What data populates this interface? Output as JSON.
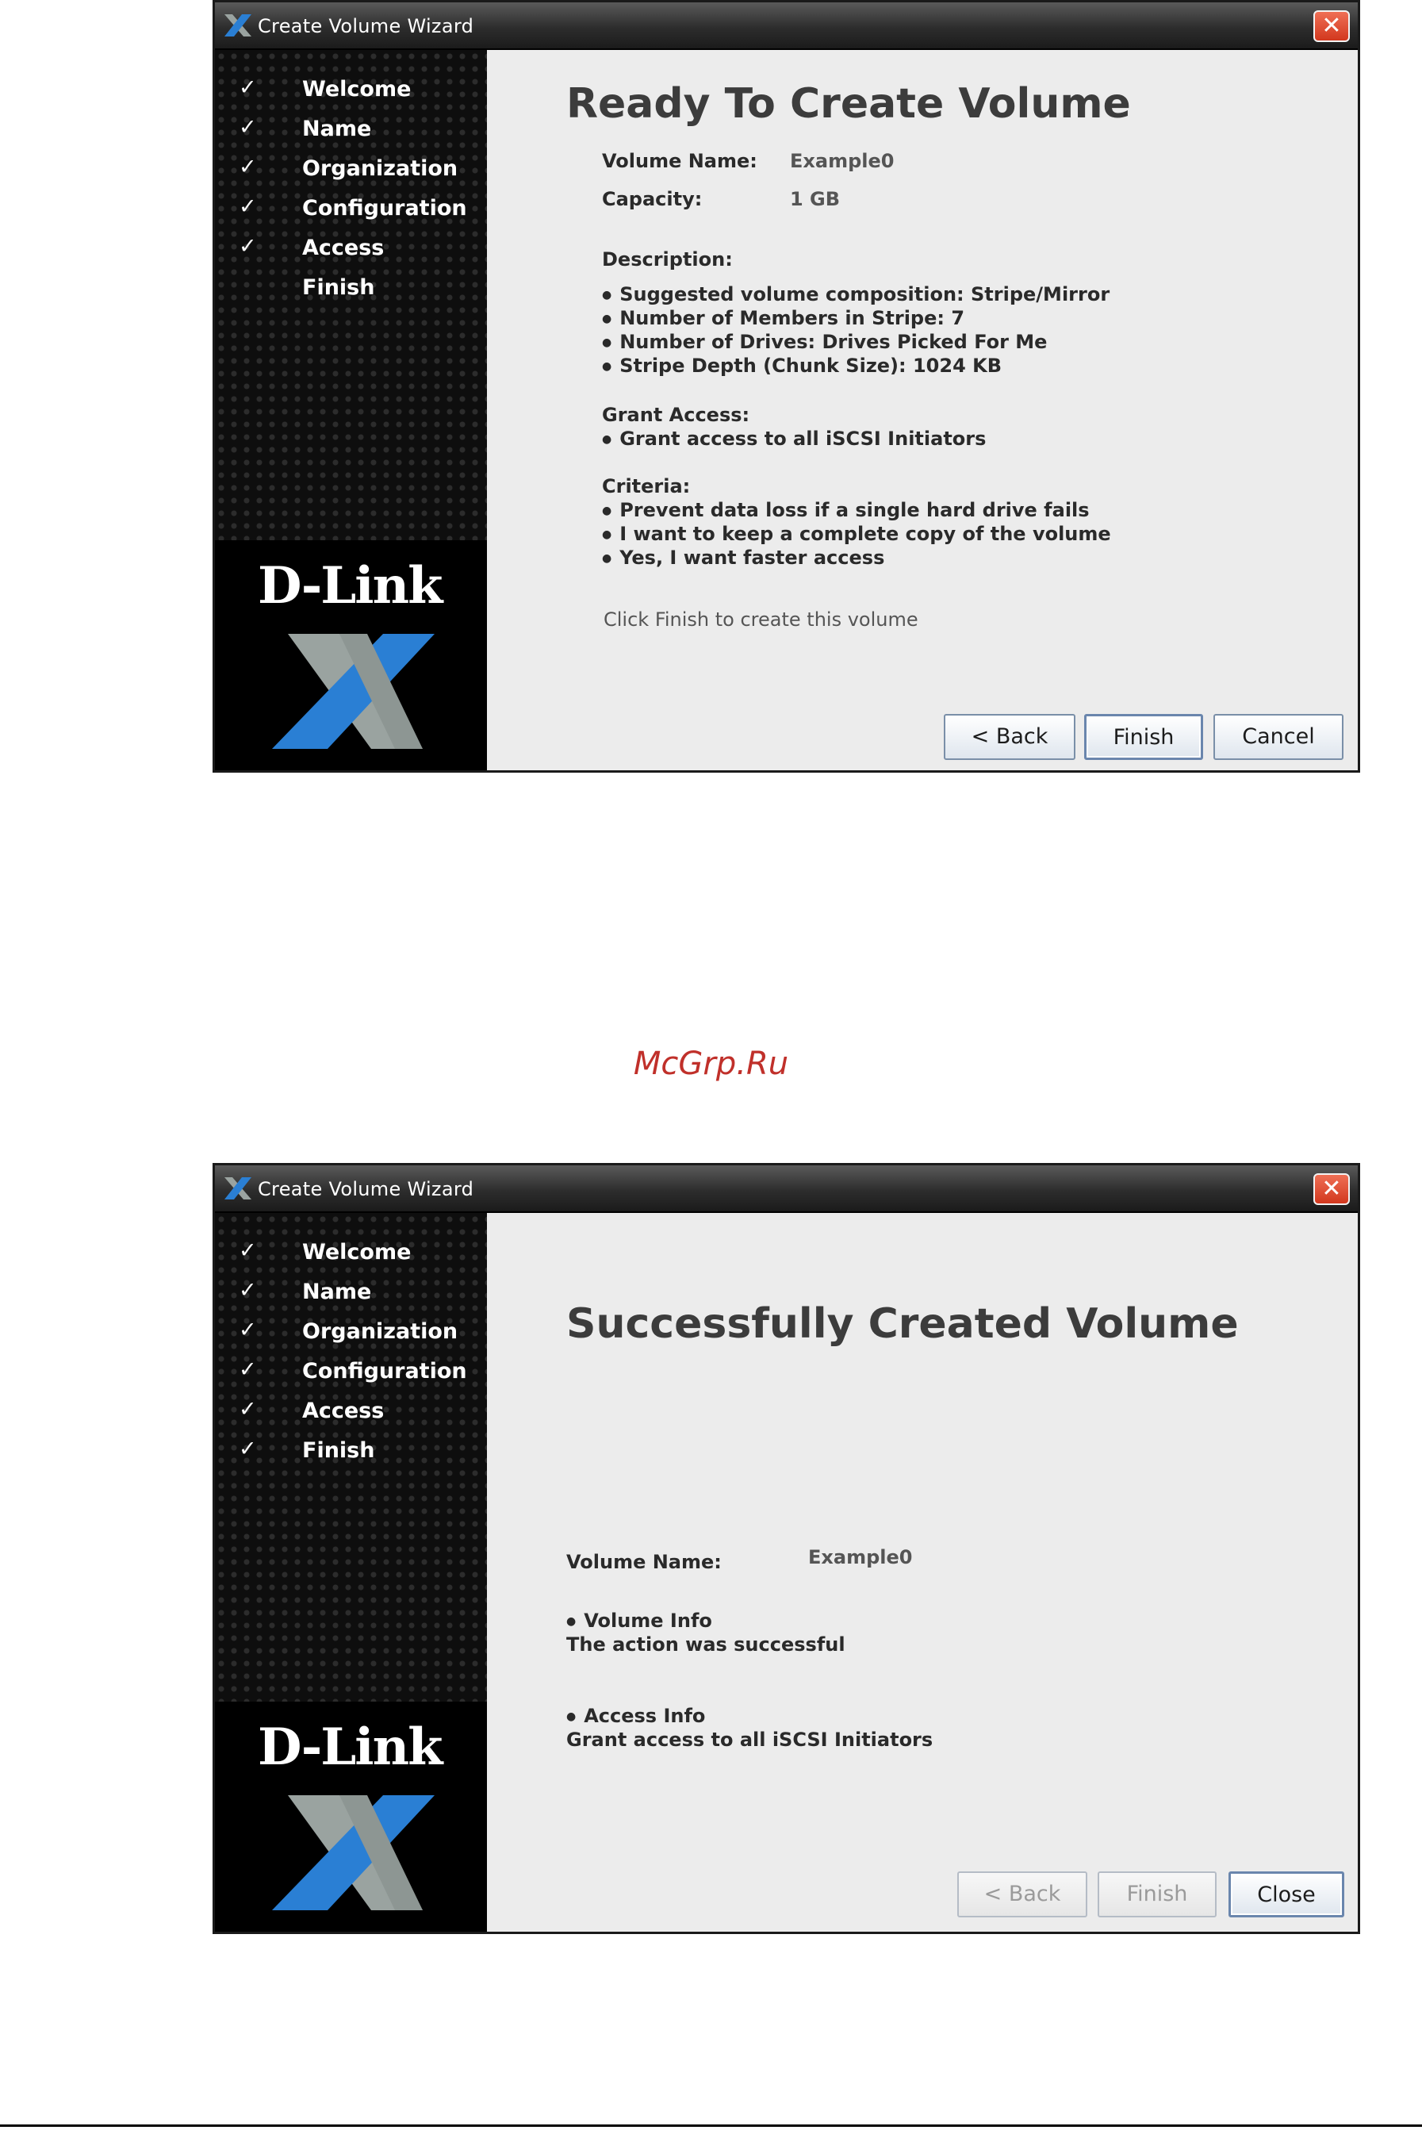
{
  "dialogs": [
    {
      "title": "Create Volume Wizard",
      "close_symbol": "✕",
      "steps": [
        {
          "label": "Welcome",
          "checked": true
        },
        {
          "label": "Name",
          "checked": true
        },
        {
          "label": "Organization",
          "checked": true
        },
        {
          "label": "Configuration",
          "checked": true
        },
        {
          "label": "Access",
          "checked": true
        },
        {
          "label": "Finish",
          "checked": false
        }
      ],
      "logo_text": "D-Link",
      "heading": "Ready To Create Volume",
      "volume_name_label": "Volume Name:",
      "volume_name_value": "Example0",
      "capacity_label": "Capacity:",
      "capacity_value": "1 GB",
      "description_label": "Description:",
      "description_items": [
        "Suggested volume composition:  Stripe/Mirror",
        "Number of Members in Stripe:   7",
        "Number of Drives:    Drives Picked For Me",
        "Stripe Depth (Chunk Size):   1024 KB"
      ],
      "grant_access_label": "Grant Access:",
      "grant_access_items": [
        "Grant access to all iSCSI Initiators"
      ],
      "criteria_label": "Criteria:",
      "criteria_items": [
        "Prevent data loss if a single hard drive fails",
        "I want to keep a complete copy of the volume",
        "Yes, I want faster access"
      ],
      "instruction": "Click Finish to create this volume",
      "buttons": {
        "back": "< Back",
        "finish": "Finish",
        "cancel": "Cancel"
      }
    },
    {
      "title": "Create Volume Wizard",
      "close_symbol": "✕",
      "steps": [
        {
          "label": "Welcome",
          "checked": true
        },
        {
          "label": "Name",
          "checked": true
        },
        {
          "label": "Organization",
          "checked": true
        },
        {
          "label": "Configuration",
          "checked": true
        },
        {
          "label": "Access",
          "checked": true
        },
        {
          "label": "Finish",
          "checked": true
        }
      ],
      "logo_text": "D-Link",
      "heading": "Successfully Created Volume",
      "volume_name_label": "Volume Name:",
      "volume_name_value": "Example0",
      "volume_info_title": "Volume Info",
      "volume_info_text": "The action was successful",
      "access_info_title": "Access Info",
      "access_info_text": "Grant access to all iSCSI Initiators",
      "buttons": {
        "back": "< Back",
        "finish": "Finish",
        "close": "Close"
      }
    }
  ],
  "watermark": "McGrp.Ru",
  "check_symbol": "✓",
  "colors": {
    "close_red": "#d2381e",
    "logo_blue": "#2a7fd4",
    "logo_gray": "#9aa3a0",
    "watermark_red": "#c0302a"
  },
  "icons": [
    "x-logo-icon",
    "close-icon",
    "check-icon"
  ]
}
